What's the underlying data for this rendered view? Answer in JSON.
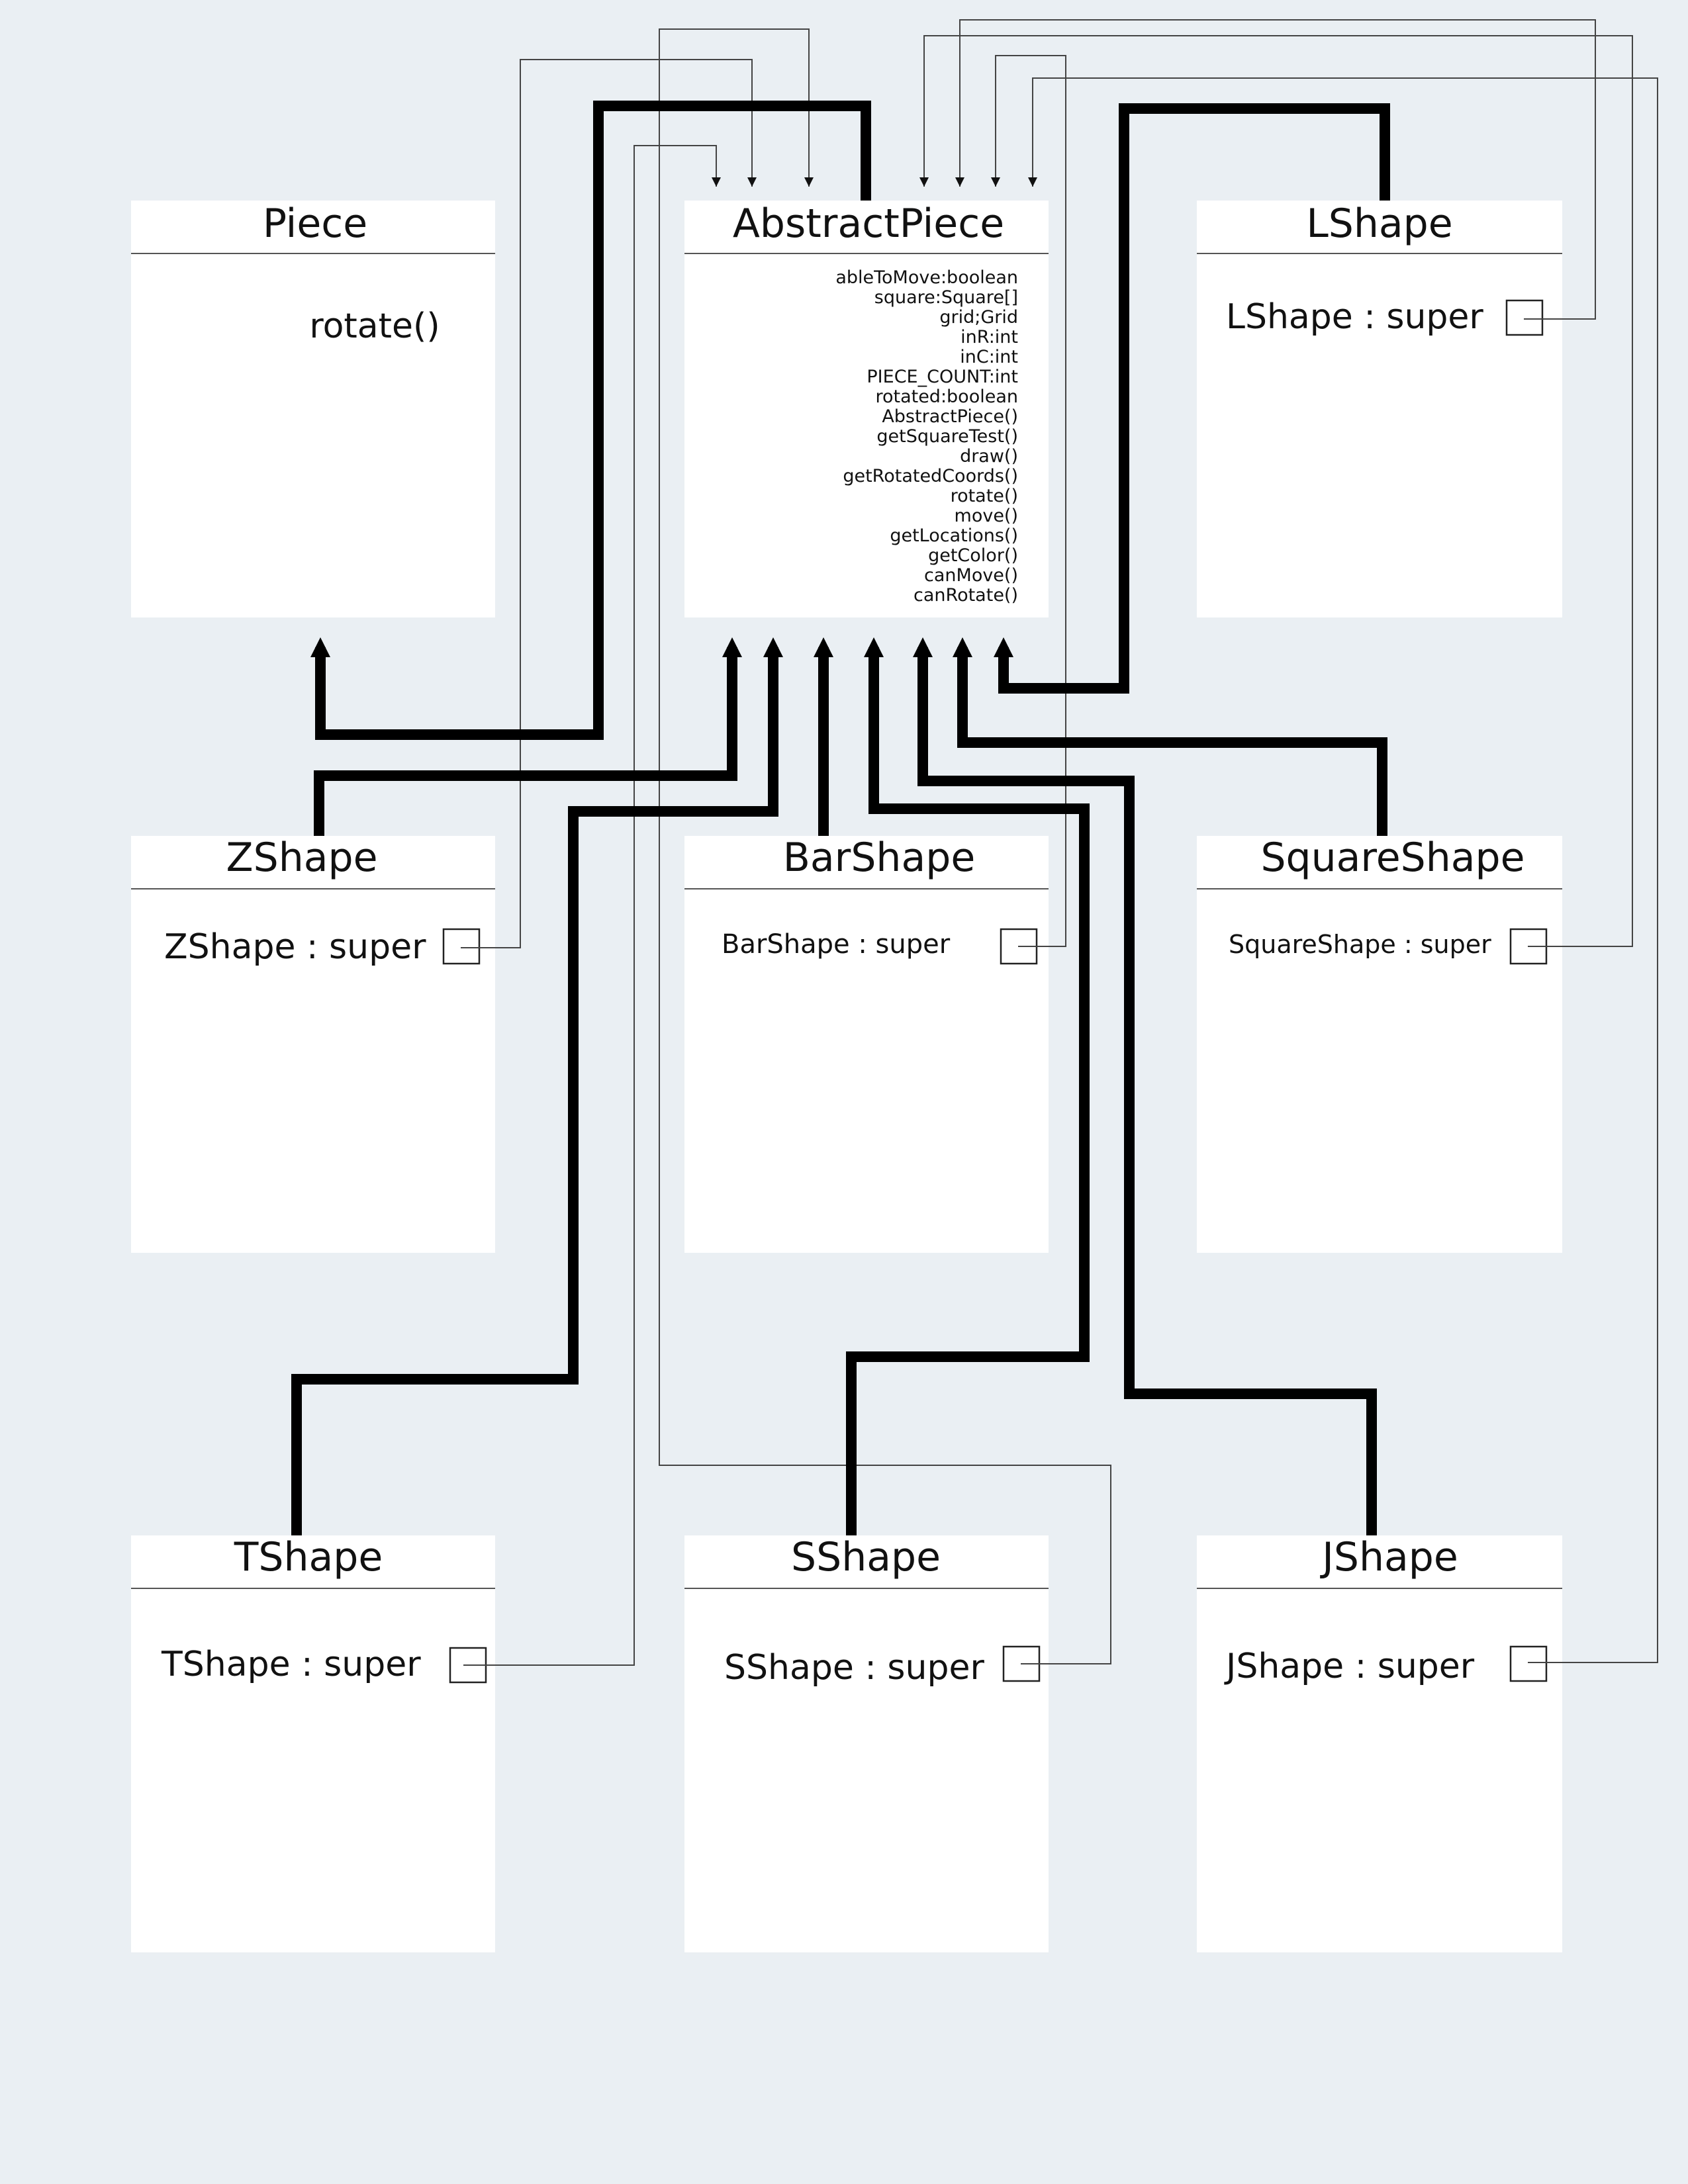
{
  "boxes": {
    "piece": {
      "title": "Piece",
      "members": [
        "rotate()"
      ]
    },
    "abstract_piece": {
      "title": "AbstractPiece",
      "members": [
        "ableToMove:boolean",
        "square:Square[]",
        "grid;Grid",
        "inR:int",
        "inC:int",
        "PIECE_COUNT:int",
        "rotated:boolean",
        "AbstractPiece()",
        "getSquareTest()",
        "draw()",
        "getRotatedCoords()",
        "rotate()",
        "move()",
        "getLocations()",
        "getColor()",
        "canMove()",
        "canRotate()"
      ]
    },
    "lshape": {
      "title": "LShape",
      "members": [
        "LShape : super"
      ]
    },
    "zshape": {
      "title": "ZShape",
      "members": [
        "ZShape : super"
      ]
    },
    "barshape": {
      "title": "BarShape",
      "members": [
        "BarShape : super"
      ]
    },
    "squareshape": {
      "title": "SquareShape",
      "members": [
        "SquareShape : super"
      ]
    },
    "tshape": {
      "title": "TShape",
      "members": [
        "TShape : super"
      ]
    },
    "sshape": {
      "title": "SShape",
      "members": [
        "SShape : super"
      ]
    },
    "jshape": {
      "title": "JShape",
      "members": [
        "JShape : super"
      ]
    }
  }
}
